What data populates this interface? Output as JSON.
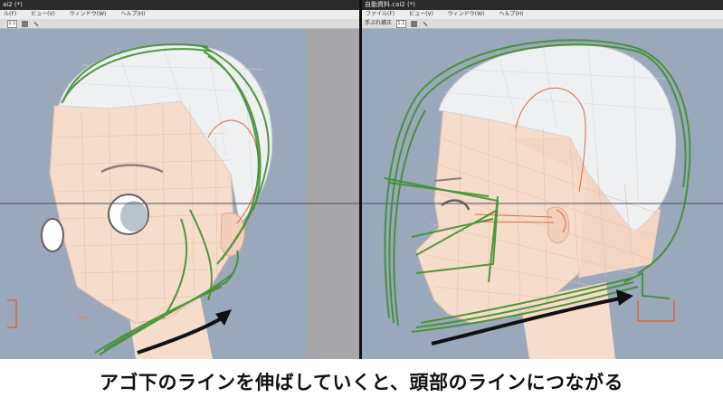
{
  "left_window": {
    "title": "ai2 (*)",
    "menu": [
      "ル(F)",
      "ビュー(V)",
      "ウィンドウ(W)",
      "ヘルプ(H)"
    ],
    "toolbar": {
      "label": "",
      "zoom": "1:1"
    }
  },
  "right_window": {
    "title": "自動資料.cai2 (*)",
    "menu": [
      "ファイル(F)",
      "ビュー(V)",
      "ウィンドウ(W)",
      "ヘルプ(H)"
    ],
    "toolbar": {
      "label": "手ぶれ補正",
      "zoom": "1:1"
    }
  },
  "caption": "アゴ下のラインを伸ばしていくと、頭部のラインにつながる",
  "colors": {
    "viewport_bg": "#9aa8bb",
    "skin": "#f6dccb",
    "hair": "#eef0f2",
    "stroke_green": "#3f8f2e",
    "arrow": "#111111",
    "guide_orange": "#e0663a"
  }
}
